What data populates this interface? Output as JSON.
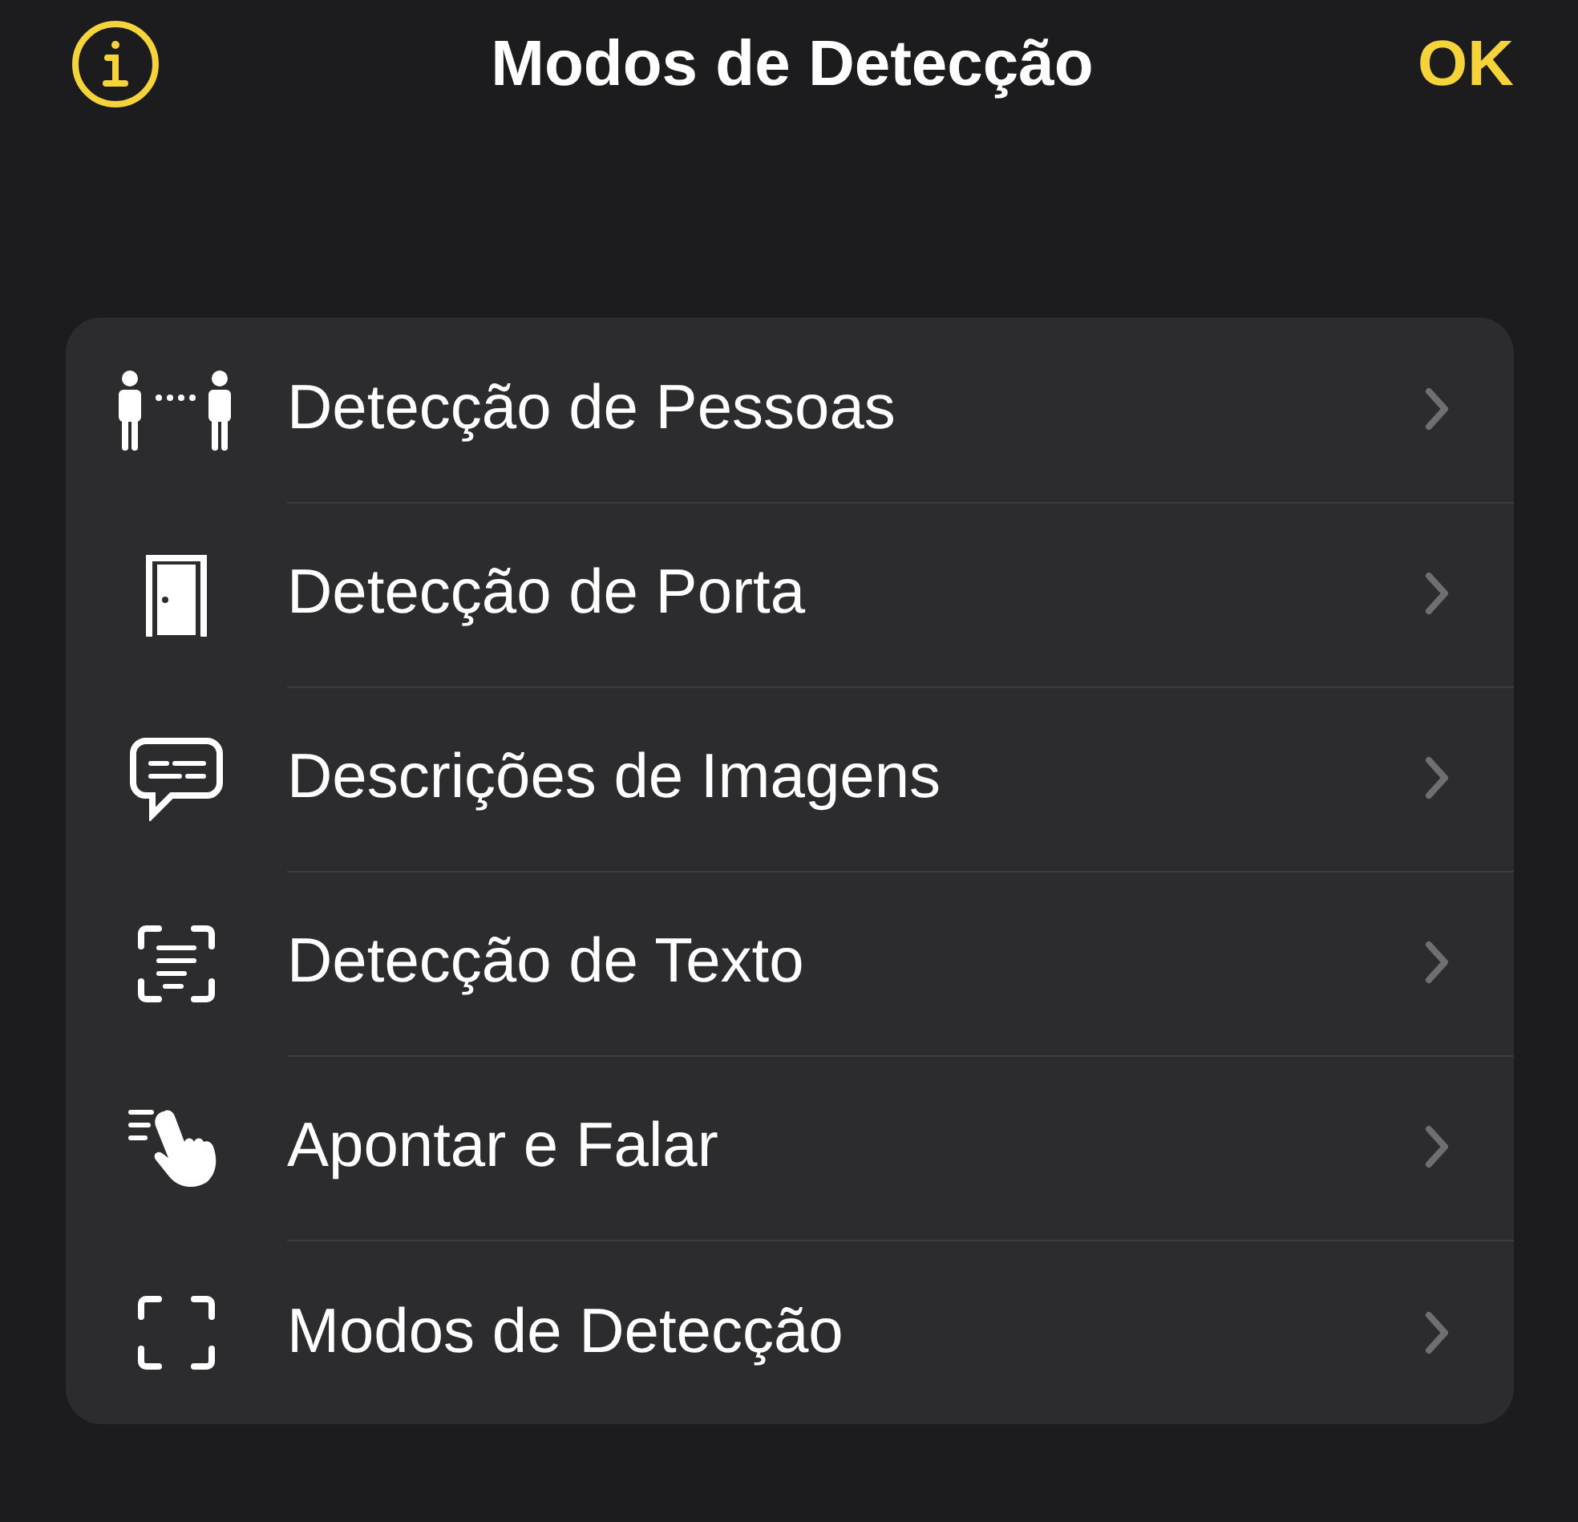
{
  "header": {
    "title": "Modos de Detecção",
    "done": "OK"
  },
  "items": [
    {
      "kind": "people",
      "label": "Detecção de Pessoas"
    },
    {
      "kind": "door",
      "label": "Detecção de Porta"
    },
    {
      "kind": "caption",
      "label": "Descrições de Imagens"
    },
    {
      "kind": "text",
      "label": "Detecção de Texto"
    },
    {
      "kind": "point",
      "label": "Apontar e Falar"
    },
    {
      "kind": "frame",
      "label": "Modos de Detecção"
    }
  ]
}
